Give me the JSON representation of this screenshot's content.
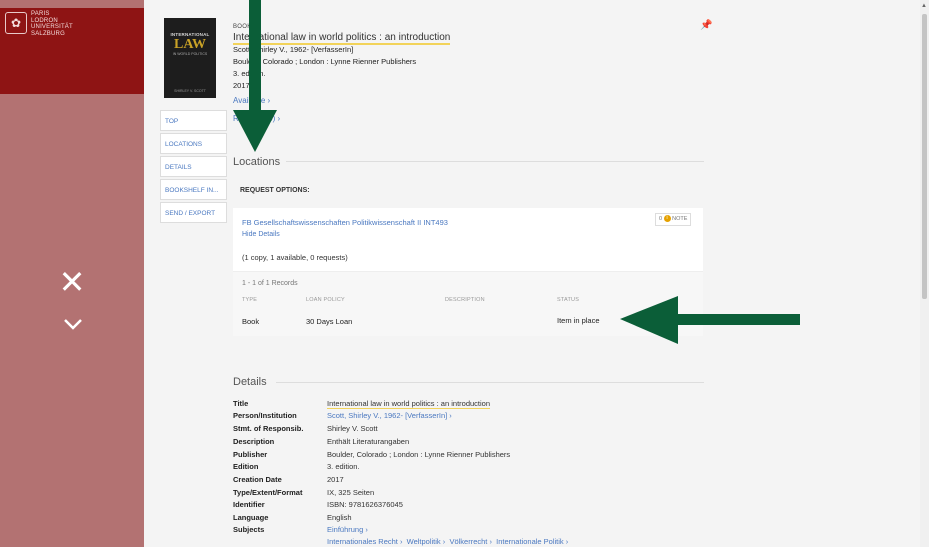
{
  "logo": {
    "lines": [
      "PARIS",
      "LODRON",
      "UNIVERSITÄT",
      "SALZBURG"
    ]
  },
  "book": {
    "cover": {
      "line1": "INTERNATIONAL",
      "line2": "LAW",
      "line3": "IN WORLD POLITICS",
      "author": "SHIRLEY V. SCOTT"
    },
    "format": "BOOK",
    "title": "International law in world politics : an introduction",
    "author": "Scott, Shirley V., 1962- [VerfasserIn]",
    "publisher": "Boulder, Colorado ; London : Lynne Rienner Publishers",
    "edition": "3. edition.",
    "year": "2017",
    "availability": "Available",
    "reviews": "Reviews (5)"
  },
  "nav": [
    "TOP",
    "LOCATIONS",
    "DETAILS",
    "BOOKSHELF IN...",
    "SEND / EXPORT"
  ],
  "locations": {
    "heading": "Locations",
    "request_options": "REQUEST OPTIONS:",
    "library": "FB Gesellschaftswissenschaften  Politikwissenschaft II  INT493",
    "note": {
      "count": "0",
      "label": "NOTE"
    },
    "hide_details": "Hide Details",
    "copy_summary": "(1 copy, 1 available, 0 requests)",
    "records_count": "1 - 1 of 1 Records",
    "columns": [
      "TYPE",
      "LOAN POLICY",
      "DESCRIPTION",
      "STATUS"
    ],
    "row": {
      "type": "Book",
      "loan_policy": "30 Days Loan",
      "description": "",
      "status": "Item in place"
    }
  },
  "details": {
    "heading": "Details",
    "rows": [
      {
        "label": "Title",
        "value": "International law in world politics : an introduction"
      },
      {
        "label": "Person/Institution",
        "value": "Scott, Shirley V., 1962- [VerfasserIn]"
      },
      {
        "label": "Stmt. of Responsib.",
        "value": "Shirley V. Scott"
      },
      {
        "label": "Description",
        "value": "Enthält Literaturangaben"
      },
      {
        "label": "Publisher",
        "value": "Boulder, Colorado ; London : Lynne Rienner Publishers"
      },
      {
        "label": "Edition",
        "value": "3. edition."
      },
      {
        "label": "Creation Date",
        "value": "2017"
      },
      {
        "label": "Type/Extent/Format",
        "value": "IX, 325 Seiten"
      },
      {
        "label": "Identifier",
        "value": "ISBN: 9781626376045"
      },
      {
        "label": "Language",
        "value": "English"
      },
      {
        "label": "Subjects",
        "value": "Einführung"
      }
    ],
    "subjects_more": [
      "Internationales Recht",
      "Weltpolitik",
      "Völkerrecht",
      "Internationale Politik"
    ]
  },
  "colors": {
    "accent_link": "#4a78c0",
    "brand_red": "#8e1414",
    "overlay": "#b37272",
    "highlight": "#f2d35a",
    "arrow": "#0b5e38"
  }
}
